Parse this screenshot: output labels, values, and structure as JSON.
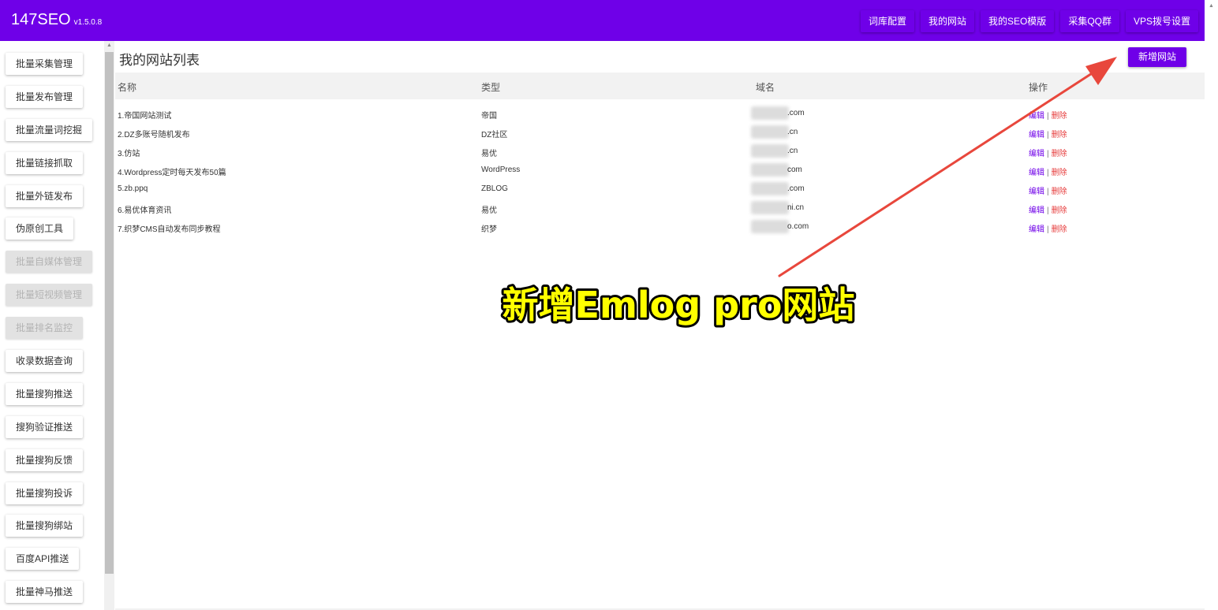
{
  "app": {
    "name": "147SEO",
    "version": "v1.5.0.8"
  },
  "nav": [
    {
      "label": "词库配置"
    },
    {
      "label": "我的网站"
    },
    {
      "label": "我的SEO模版"
    },
    {
      "label": "采集QQ群"
    },
    {
      "label": "VPS拨号设置"
    }
  ],
  "sidebar": {
    "items": [
      {
        "label": "批量采集管理",
        "disabled": false
      },
      {
        "label": "批量发布管理",
        "disabled": false
      },
      {
        "label": "批量流量词挖掘",
        "disabled": false
      },
      {
        "label": "批量链接抓取",
        "disabled": false
      },
      {
        "label": "批量外链发布",
        "disabled": false
      },
      {
        "label": "伪原创工具",
        "disabled": false
      },
      {
        "label": "批量自媒体管理",
        "disabled": true
      },
      {
        "label": "批量短视频管理",
        "disabled": true
      },
      {
        "label": "批量排名监控",
        "disabled": true
      },
      {
        "label": "收录数据查询",
        "disabled": false
      },
      {
        "label": "批量搜狗推送",
        "disabled": false
      },
      {
        "label": "搜狗验证推送",
        "disabled": false
      },
      {
        "label": "批量搜狗反馈",
        "disabled": false
      },
      {
        "label": "批量搜狗投诉",
        "disabled": false
      },
      {
        "label": "批量搜狗绑站",
        "disabled": false
      },
      {
        "label": "百度API推送",
        "disabled": false
      },
      {
        "label": "批量神马推送",
        "disabled": false
      }
    ]
  },
  "main": {
    "title": "我的网站列表",
    "add_button": "新增网站",
    "table": {
      "headers": [
        "名称",
        "类型",
        "域名",
        "操作"
      ],
      "rows": [
        {
          "name": "1.帝国网站测试",
          "type": "帝国",
          "domain": ".com"
        },
        {
          "name": "2.DZ多账号随机发布",
          "type": "DZ社区",
          "domain": ".cn"
        },
        {
          "name": "3.仿站",
          "type": "易优",
          "domain": ".cn"
        },
        {
          "name": "4.Wordpress定时每天发布50篇",
          "type": "WordPress",
          "domain": "com"
        },
        {
          "name": "5.zb.ppq",
          "type": "ZBLOG",
          "domain": ".com"
        },
        {
          "name": "6.易优体育资讯",
          "type": "易优",
          "domain": "ni.cn"
        },
        {
          "name": "7.织梦CMS自动发布同步教程",
          "type": "织梦",
          "domain": "o.com"
        }
      ],
      "edit_label": "编辑",
      "delete_label": "删除",
      "separator": "|"
    }
  },
  "annotation": {
    "text": "新增Emlog pro网站"
  },
  "colors": {
    "accent": "#6f00e8",
    "danger": "#e63a3a",
    "arrow": "#e8473c",
    "annotation_fill": "#ffff00"
  }
}
